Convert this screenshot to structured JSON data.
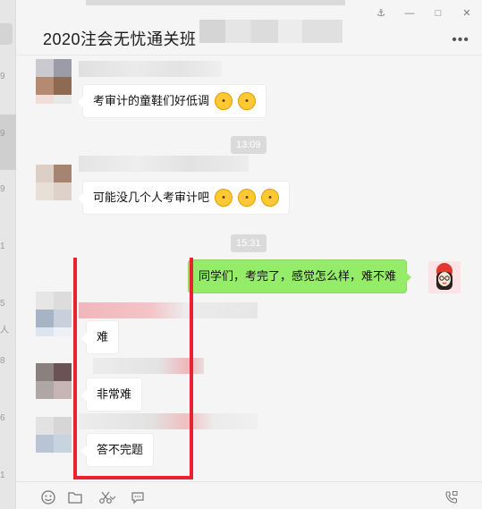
{
  "sidebar": {
    "partial_items": [
      "9",
      "9",
      "9",
      "1",
      "5",
      "人",
      "8",
      "6",
      "1"
    ]
  },
  "header": {
    "title": "2020注会无忧通关班",
    "window_controls": [
      "pin-icon",
      "minimize-icon",
      "maximize-icon",
      "close-icon"
    ],
    "more_icon": "more-icon"
  },
  "messages": [
    {
      "sender": "other",
      "text": "考审计的童鞋们好低调",
      "emojis": [
        "thinking-emoji",
        "thinking-emoji"
      ]
    },
    {
      "type": "time",
      "text": "13:09"
    },
    {
      "sender": "other",
      "text": "可能没几个人考审计吧",
      "emojis": [
        "grin-emoji",
        "grin-emoji",
        "grin-emoji"
      ]
    },
    {
      "type": "time",
      "text": "15:31"
    },
    {
      "sender": "me",
      "text": "同学们，考完了，感觉怎么样，难不难"
    },
    {
      "sender": "other",
      "text": "难"
    },
    {
      "sender": "other",
      "text": "非常难"
    },
    {
      "sender": "other",
      "text": "答不完题"
    }
  ],
  "toolbar": {
    "icons": [
      "emoji-icon",
      "folder-icon",
      "scissors-icon",
      "chat-bubble-icon",
      "video-call-icon"
    ]
  },
  "colors": {
    "my_bubble": "#95ec69",
    "their_bubble": "#ffffff",
    "highlight_frame": "#e8232f",
    "background": "#f5f5f5"
  }
}
